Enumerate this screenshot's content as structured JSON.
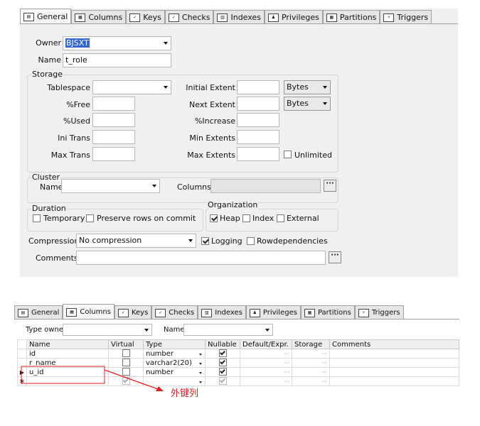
{
  "top_tabs": [
    {
      "label": "General",
      "icon": "general-tab-icon",
      "active": true
    },
    {
      "label": "Columns",
      "icon": "columns-tab-icon"
    },
    {
      "label": "Keys",
      "icon": "keys-tab-icon"
    },
    {
      "label": "Checks",
      "icon": "checks-tab-icon"
    },
    {
      "label": "Indexes",
      "icon": "indexes-tab-icon"
    },
    {
      "label": "Privileges",
      "icon": "privileges-tab-icon"
    },
    {
      "label": "Partitions",
      "icon": "partitions-tab-icon"
    },
    {
      "label": "Triggers",
      "icon": "triggers-tab-icon"
    }
  ],
  "general": {
    "owner_label": "Owner",
    "owner_value": "BJSXT",
    "name_label": "Name",
    "name_value": "t_role",
    "storage_label": "Storage",
    "tablespace_label": "Tablespace",
    "pctfree_label": "%Free",
    "pctused_label": "%Used",
    "initrans_label": "Ini Trans",
    "maxtrans_label": "Max Trans",
    "initial_extent_label": "Initial Extent",
    "initial_extent_unit": "Bytes",
    "next_extent_label": "Next Extent",
    "next_extent_unit": "Bytes",
    "pctincrease_label": "%Increase",
    "min_extents_label": "Min Extents",
    "max_extents_label": "Max Extents",
    "unlimited_label": "Unlimited",
    "cluster_label": "Cluster",
    "cluster_name_label": "Name",
    "cluster_columns_label": "Columns",
    "duration_label": "Duration",
    "temporary_label": "Temporary",
    "preserve_label": "Preserve rows on commit",
    "organization_label": "Organization",
    "heap_label": "Heap",
    "index_label": "Index",
    "external_label": "External",
    "compression_label": "Compression",
    "compression_value": "No compression",
    "logging_label": "Logging",
    "rowdep_label": "Rowdependencies",
    "comments_label": "Comments",
    "ellipsis": "···"
  },
  "bottom_tabs": [
    {
      "label": "General",
      "icon": "general-tab-icon"
    },
    {
      "label": "Columns",
      "icon": "columns-tab-icon",
      "active": true
    },
    {
      "label": "Keys",
      "icon": "keys-tab-icon"
    },
    {
      "label": "Checks",
      "icon": "checks-tab-icon"
    },
    {
      "label": "Indexes",
      "icon": "indexes-tab-icon"
    },
    {
      "label": "Privileges",
      "icon": "privileges-tab-icon"
    },
    {
      "label": "Partitions",
      "icon": "partitions-tab-icon"
    },
    {
      "label": "Triggers",
      "icon": "triggers-tab-icon"
    }
  ],
  "columns": {
    "type_owner_label": "Type owner",
    "name_label": "Name",
    "headers": [
      "Name",
      "Virtual",
      "Type",
      "Nullable",
      "Default/Expr.",
      "Storage",
      "Comments"
    ],
    "rows": [
      {
        "name": "id",
        "type": "number",
        "nullable": true
      },
      {
        "name": "r_name",
        "type": "varchar2(20)",
        "nullable": true
      },
      {
        "name": "u_id",
        "type": "number",
        "nullable": true
      },
      {
        "name": "",
        "type": "",
        "nullable": true
      }
    ],
    "current_row_marker": "▶",
    "new_row_marker": "∗",
    "annotation": "外键列",
    "annotation_color": "#e02020"
  }
}
